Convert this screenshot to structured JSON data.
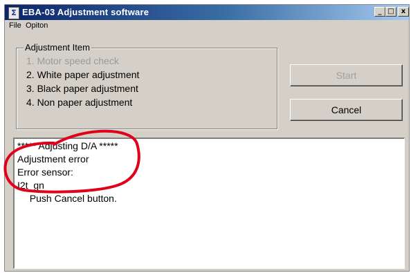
{
  "window": {
    "title": "EBA-03 Adjustment software",
    "app_icon_glyph": "Σ",
    "minimize_glyph": "_",
    "maximize_glyph": "□",
    "close_glyph": "x"
  },
  "menu": [
    "File",
    "Opiton"
  ],
  "adjustment_group": {
    "label": "Adjustment Item",
    "items": [
      {
        "text": "1. Motor speed check",
        "enabled": false
      },
      {
        "text": "2. White paper adjustment",
        "enabled": true
      },
      {
        "text": "3. Black paper adjustment",
        "enabled": true
      },
      {
        "text": "4. Non paper adjustment",
        "enabled": true
      }
    ]
  },
  "buttons": {
    "start": {
      "label": "Start",
      "enabled": false
    },
    "cancel": {
      "label": "Cancel",
      "enabled": true
    }
  },
  "log": [
    "***** Adjusting D/A *****",
    "Adjustment error",
    "Error sensor:",
    "I2t_gn",
    "  Push Cancel button."
  ],
  "colors": {
    "annotation": "#e0001a",
    "title_bar": "#0a246a"
  }
}
